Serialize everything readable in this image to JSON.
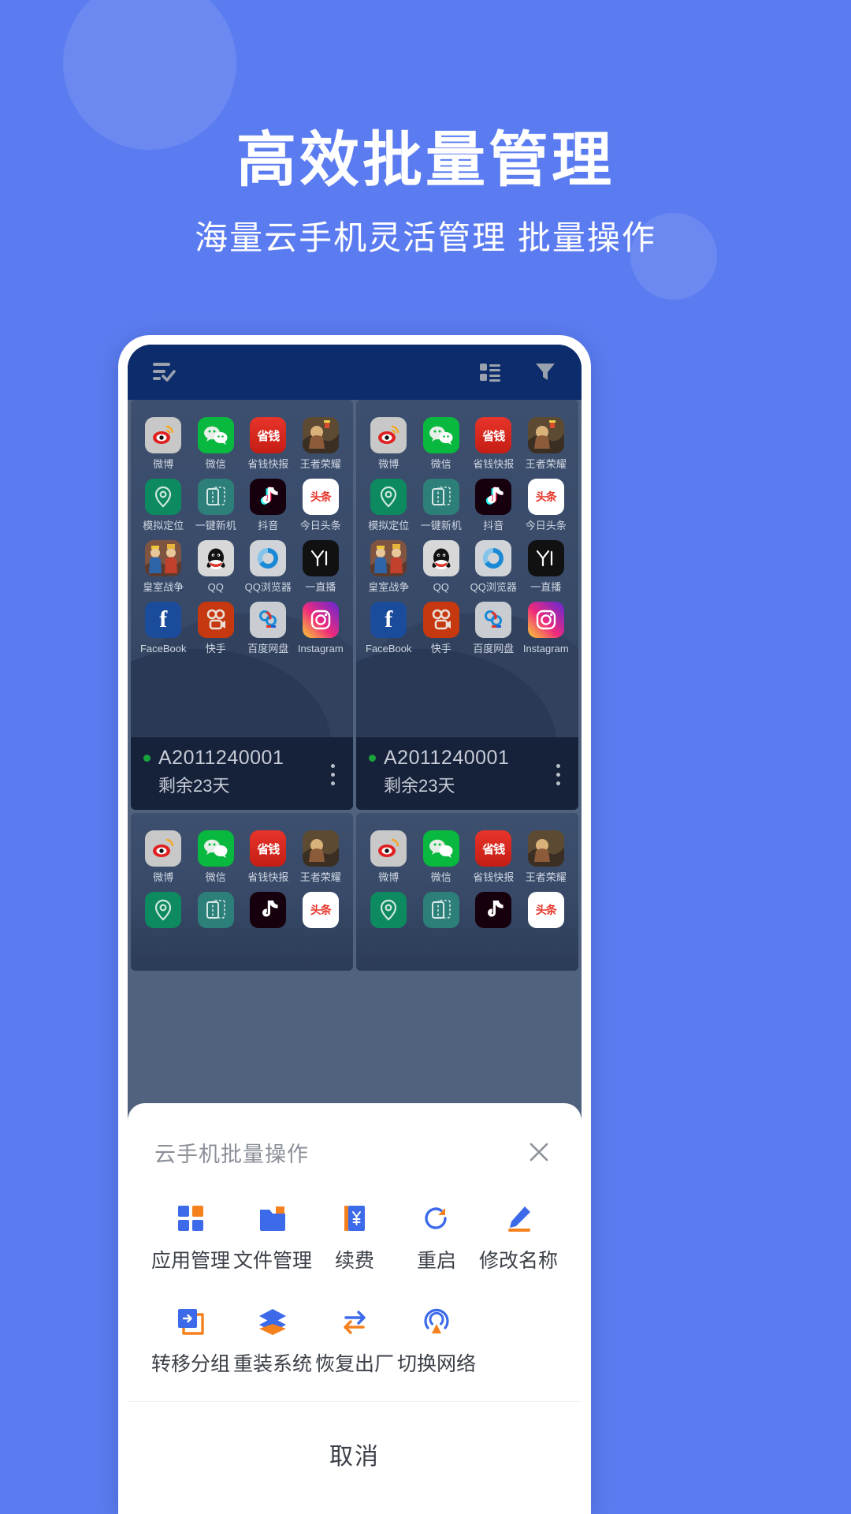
{
  "hero": {
    "title": "高效批量管理",
    "subtitle": "海量云手机灵活管理 批量操作"
  },
  "theme": {
    "page_background": "#5b7cf0",
    "phone_screen_background": "#0d2c6b",
    "grid_background": "#51627f",
    "accent_blue": "#3d6ae8",
    "accent_orange": "#f5801e",
    "status_green": "#19a33c",
    "device_footer": "#16213a"
  },
  "appbar": {
    "select_all_icon": "checklist-icon",
    "layout_toggle_icon": "list-view-icon",
    "filter_icon": "filter-icon"
  },
  "apps": [
    {
      "label": "微博",
      "icon": "weibo-icon"
    },
    {
      "label": "微信",
      "icon": "wechat-icon"
    },
    {
      "label": "省钱快报",
      "icon": "shengqian-icon",
      "glyph": "省钱"
    },
    {
      "label": "王者荣耀",
      "icon": "honor-of-kings-icon"
    },
    {
      "label": "模拟定位",
      "icon": "mock-location-icon"
    },
    {
      "label": "一键新机",
      "icon": "new-device-icon"
    },
    {
      "label": "抖音",
      "icon": "douyin-icon"
    },
    {
      "label": "今日头条",
      "icon": "toutiao-icon",
      "glyph": "头条"
    },
    {
      "label": "皇室战争",
      "icon": "clash-royale-icon"
    },
    {
      "label": "QQ",
      "icon": "qq-icon"
    },
    {
      "label": "QQ浏览器",
      "icon": "qq-browser-icon"
    },
    {
      "label": "一直播",
      "icon": "yizhibo-icon"
    },
    {
      "label": "FaceBook",
      "icon": "facebook-icon",
      "glyph": "f"
    },
    {
      "label": "快手",
      "icon": "kuaishou-icon"
    },
    {
      "label": "百度网盘",
      "icon": "baidu-netdisk-icon"
    },
    {
      "label": "Instagram",
      "icon": "instagram-icon"
    }
  ],
  "devices": [
    {
      "name": "A2011240001",
      "remaining": "剩余23天",
      "status": "online",
      "menu_icon": "kebab-menu-icon"
    },
    {
      "name": "A2011240001",
      "remaining": "剩余23天",
      "status": "online",
      "menu_icon": "kebab-menu-icon"
    }
  ],
  "sheet": {
    "title": "云手机批量操作",
    "close_icon": "close-icon",
    "cancel_label": "取消",
    "actions": [
      {
        "label": "应用管理",
        "icon": "apps-grid-icon"
      },
      {
        "label": "文件管理",
        "icon": "folder-icon"
      },
      {
        "label": "续费",
        "icon": "renew-payment-icon"
      },
      {
        "label": "重启",
        "icon": "restart-icon"
      },
      {
        "label": "修改名称",
        "icon": "edit-pencil-icon"
      },
      {
        "label": "转移分组",
        "icon": "move-group-icon"
      },
      {
        "label": "重装系统",
        "icon": "layers-reinstall-icon"
      },
      {
        "label": "恢复出厂",
        "icon": "factory-reset-icon"
      },
      {
        "label": "切换网络",
        "icon": "switch-network-icon"
      }
    ]
  }
}
